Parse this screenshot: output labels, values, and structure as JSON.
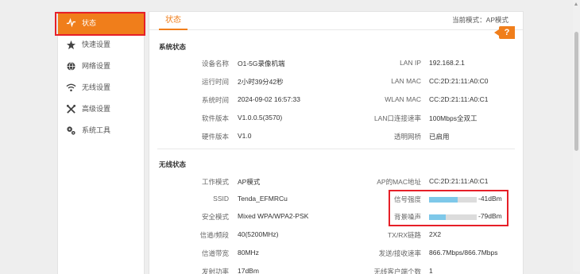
{
  "sidebar": {
    "items": [
      {
        "label": "状态",
        "icon": "pulse-icon",
        "active": true
      },
      {
        "label": "快速设置",
        "icon": "star-icon",
        "active": false
      },
      {
        "label": "网络设置",
        "icon": "globe-icon",
        "active": false
      },
      {
        "label": "无线设置",
        "icon": "wifi-icon",
        "active": false
      },
      {
        "label": "高级设置",
        "icon": "tools-icon",
        "active": false
      },
      {
        "label": "系统工具",
        "icon": "gears-icon",
        "active": false
      }
    ]
  },
  "header": {
    "tab_label": "状态",
    "mode_text": "当前模式：AP模式",
    "help_label": "?"
  },
  "system_status": {
    "title": "系统状态",
    "rows": [
      {
        "l1": "设备名称",
        "v1": "O1-5G录像机端",
        "l2": "LAN IP",
        "v2": "192.168.2.1"
      },
      {
        "l1": "运行时间",
        "v1": "2小时39分42秒",
        "l2": "LAN MAC",
        "v2": "CC:2D:21:11:A0:C0"
      },
      {
        "l1": "系统时间",
        "v1": "2024-09-02 16:57:33",
        "l2": "WLAN MAC",
        "v2": "CC:2D:21:11:A0:C1"
      },
      {
        "l1": "软件版本",
        "v1": "V1.0.0.5(3570)",
        "l2": "LAN口连接速率",
        "v2": "100Mbps全双工"
      },
      {
        "l1": "硬件版本",
        "v1": "V1.0",
        "l2": "透明网桥",
        "v2": "已启用"
      }
    ]
  },
  "wireless_status": {
    "title": "无线状态",
    "rows": [
      {
        "l1": "工作模式",
        "v1": "AP模式",
        "l2": "AP的MAC地址",
        "v2": "CC:2D:21:11:A0:C1"
      },
      {
        "l1": "SSID",
        "v1": "Tenda_EFMRCu",
        "l2": "信号强度",
        "v2": "-41dBm",
        "bar": 0.6
      },
      {
        "l1": "安全模式",
        "v1": "Mixed WPA/WPA2-PSK",
        "l2": "背景噪声",
        "v2": "-79dBm",
        "bar": 0.35
      },
      {
        "l1": "信道/频段",
        "v1": "40(5200MHz)",
        "l2": "TX/RX链路",
        "v2": "2X2"
      },
      {
        "l1": "信道带宽",
        "v1": "80MHz",
        "l2": "发送/接收速率",
        "v2": "866.7Mbps/866.7Mbps"
      },
      {
        "l1": "发射功率",
        "v1": "17dBm",
        "l2": "无线客户端个数",
        "v2": "1"
      }
    ]
  },
  "colors": {
    "accent": "#f07e1b",
    "highlight": "#e61f28",
    "bar_fill": "#7ec8e9"
  }
}
